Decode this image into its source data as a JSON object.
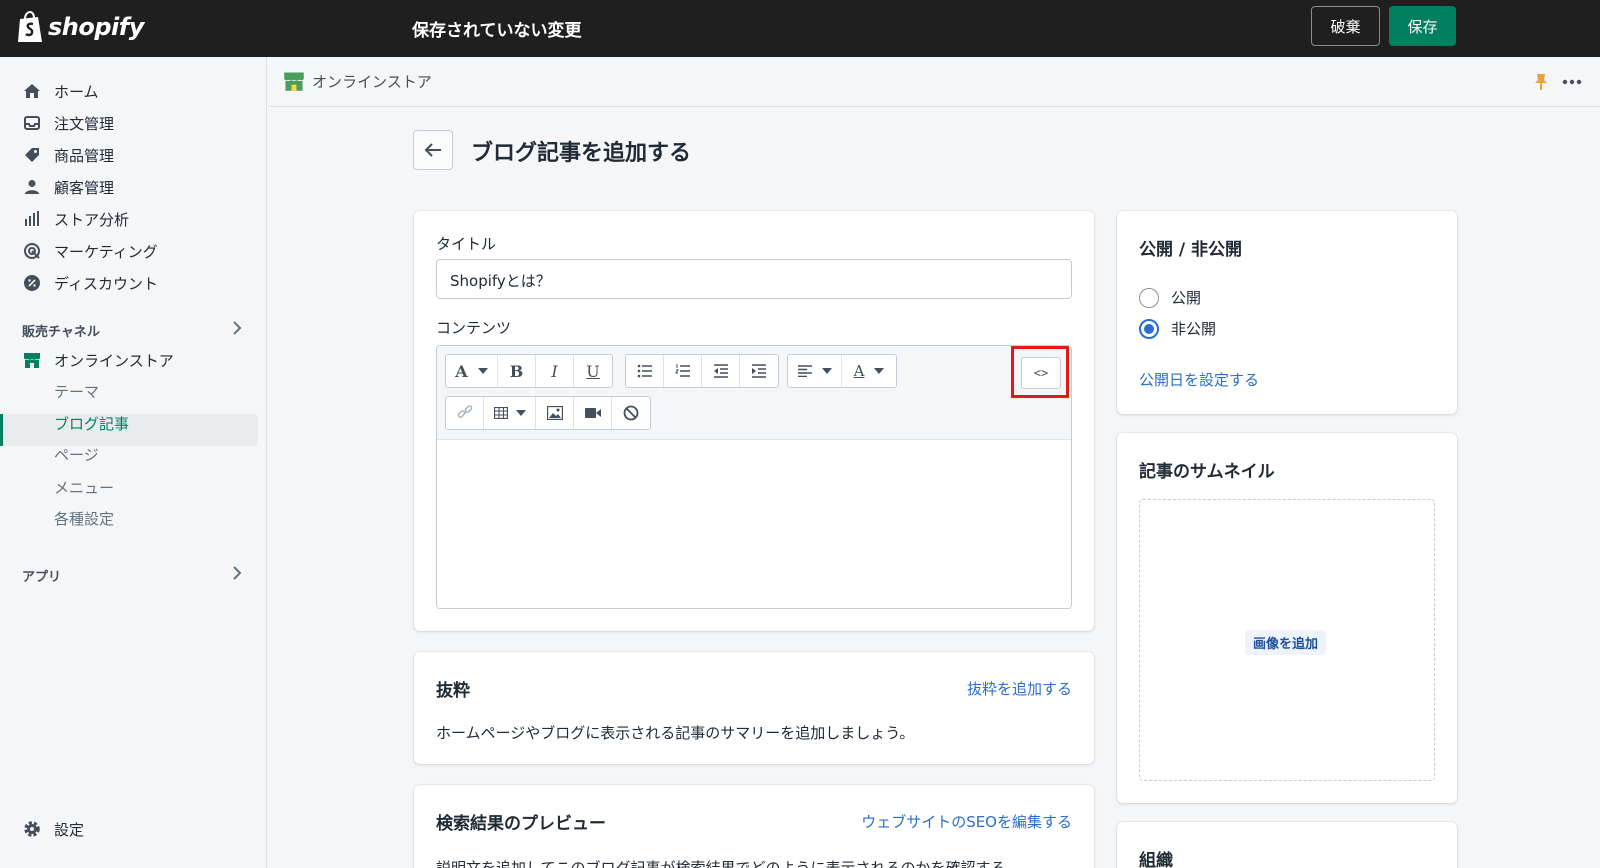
{
  "topbar": {
    "logo_text": "shopify",
    "unsaved_text": "保存されていない変更",
    "discard_label": "破棄",
    "save_label": "保存"
  },
  "sidebar": {
    "items": [
      {
        "label": "ホーム",
        "icon": "home-icon"
      },
      {
        "label": "注文管理",
        "icon": "inbox-icon"
      },
      {
        "label": "商品管理",
        "icon": "tag-icon"
      },
      {
        "label": "顧客管理",
        "icon": "person-icon"
      },
      {
        "label": "ストア分析",
        "icon": "bar-chart-icon"
      },
      {
        "label": "マーケティング",
        "icon": "target-icon"
      },
      {
        "label": "ディスカウント",
        "icon": "discount-icon"
      }
    ],
    "sales_channels_label": "販売チャネル",
    "online_store_label": "オンラインストア",
    "sub_items": [
      "テーマ",
      "ブログ記事",
      "ページ",
      "メニュー",
      "各種設定"
    ],
    "active_sub_item": "ブログ記事",
    "apps_label": "アプリ",
    "settings_label": "設定"
  },
  "header": {
    "store_name": "オンラインストア"
  },
  "page": {
    "title": "ブログ記事を追加する"
  },
  "editor_card": {
    "title_label": "タイトル",
    "title_value": "Shopifyとは？",
    "content_label": "コンテンツ",
    "html_button_label": "<>"
  },
  "excerpt_card": {
    "title": "抜粋",
    "link": "抜粋を追加する",
    "description": "ホームページやブログに表示される記事のサマリーを追加しましょう。"
  },
  "seo_card": {
    "title": "検索結果のプレビュー",
    "link": "ウェブサイトのSEOを編集する",
    "description": "説明文を追加してこのブログ記事が検索結果でどのように表示されるのかを確認する。"
  },
  "visibility_card": {
    "title": "公開 / 非公開",
    "options": [
      "公開",
      "非公開"
    ],
    "selected": "非公開",
    "set_date_link": "公開日を設定する"
  },
  "thumbnail_card": {
    "title": "記事のサムネイル",
    "add_image_label": "画像を追加"
  },
  "organization_card": {
    "title": "組織"
  },
  "colors": {
    "topbar_bg": "#1f1f1f",
    "save_green": "#00805f",
    "link_blue": "#2c6ecb",
    "highlight_red": "#e11b14",
    "active_green": "#008060"
  }
}
